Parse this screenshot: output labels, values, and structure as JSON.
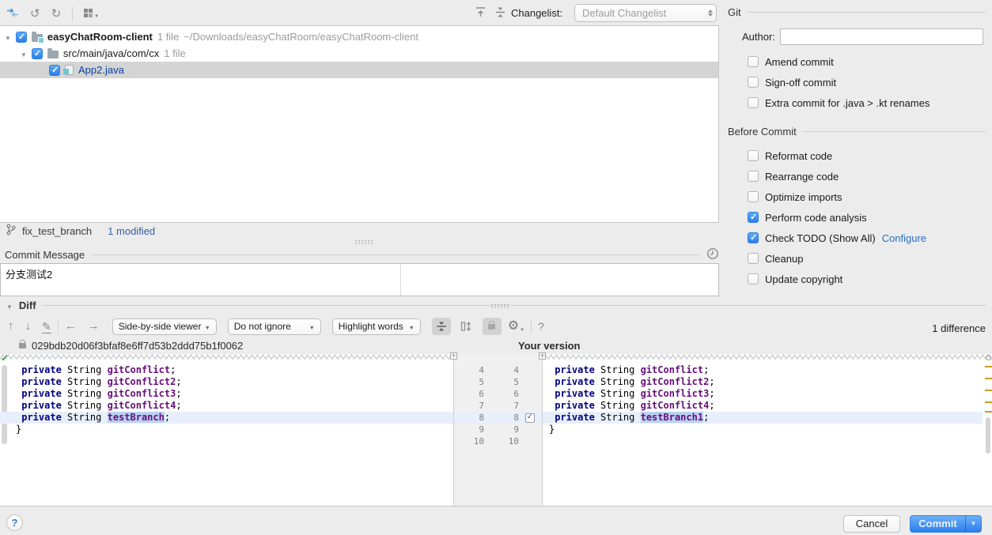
{
  "toolbar": {
    "changelist_label": "Changelist:",
    "changelist_value": "Default Changelist"
  },
  "tree": {
    "rows": [
      {
        "name": "easyChatRoom-client",
        "count": "1 file",
        "path": "~/Downloads/easyChatRoom/easyChatRoom-client"
      },
      {
        "name": "src/main/java/com/cx",
        "count": "1 file",
        "path": ""
      },
      {
        "name": "App2.java",
        "count": "",
        "path": ""
      }
    ]
  },
  "branch_bar": {
    "branch": "fix_test_branch",
    "modified": "1 modified"
  },
  "commit_message": {
    "title": "Commit Message",
    "text": "分支测试2"
  },
  "git_panel": {
    "title": "Git",
    "author_label": "Author:",
    "author_value": "",
    "options": [
      {
        "label": "Amend commit",
        "checked": false
      },
      {
        "label": "Sign-off commit",
        "checked": false
      },
      {
        "label": "Extra commit for .java > .kt renames",
        "checked": false
      }
    ],
    "before_commit_title": "Before Commit",
    "before_commit_options": [
      {
        "label": "Reformat code",
        "checked": false
      },
      {
        "label": "Rearrange code",
        "checked": false
      },
      {
        "label": "Optimize imports",
        "checked": false
      },
      {
        "label": "Perform code analysis",
        "checked": true
      },
      {
        "label": "Check TODO (Show All)",
        "checked": true,
        "link": "Configure"
      },
      {
        "label": "Cleanup",
        "checked": false
      },
      {
        "label": "Update copyright",
        "checked": false
      }
    ]
  },
  "diff": {
    "title": "Diff",
    "difference_count": "1 difference",
    "viewer_dropdown": "Side-by-side viewer",
    "ignore_dropdown": "Do not ignore",
    "highlight_dropdown": "Highlight words",
    "help": "?",
    "left_title": "029bdb20d06f3bfaf8e6ff7d53b2ddd75b1f0062",
    "right_title": "Your version",
    "gutter_rows": [
      {
        "left": "4",
        "right": "4"
      },
      {
        "left": "5",
        "right": "5"
      },
      {
        "left": "6",
        "right": "6"
      },
      {
        "left": "7",
        "right": "7"
      },
      {
        "left": "8",
        "right": "8",
        "checked": true,
        "highlight": true
      },
      {
        "left": "9",
        "right": "9"
      },
      {
        "left": "10",
        "right": "10"
      }
    ],
    "left_code": [
      {
        "tokens": [
          {
            "t": " ",
            "c": "pl"
          },
          {
            "t": "private",
            "c": "kw"
          },
          {
            "t": " String ",
            "c": "pl"
          },
          {
            "t": "gitConflict",
            "c": "fld"
          },
          {
            "t": ";",
            "c": "pl"
          }
        ]
      },
      {
        "tokens": [
          {
            "t": " ",
            "c": "pl"
          },
          {
            "t": "private",
            "c": "kw"
          },
          {
            "t": " String ",
            "c": "pl"
          },
          {
            "t": "gitConflict2",
            "c": "fld"
          },
          {
            "t": ";",
            "c": "pl"
          }
        ]
      },
      {
        "tokens": [
          {
            "t": " ",
            "c": "pl"
          },
          {
            "t": "private",
            "c": "kw"
          },
          {
            "t": " String ",
            "c": "pl"
          },
          {
            "t": "gitConflict3",
            "c": "fld"
          },
          {
            "t": ";",
            "c": "pl"
          }
        ]
      },
      {
        "tokens": [
          {
            "t": " ",
            "c": "pl"
          },
          {
            "t": "private",
            "c": "kw"
          },
          {
            "t": " String ",
            "c": "pl"
          },
          {
            "t": "gitConflict4",
            "c": "fld"
          },
          {
            "t": ";",
            "c": "pl"
          }
        ]
      },
      {
        "highlight": true,
        "tokens": [
          {
            "t": " ",
            "c": "pl"
          },
          {
            "t": "private",
            "c": "kw"
          },
          {
            "t": " String ",
            "c": "pl"
          },
          {
            "t": "testBranch",
            "c": "fld sel"
          },
          {
            "t": ";",
            "c": "pl"
          }
        ]
      },
      {
        "tokens": [
          {
            "t": "}",
            "c": "pl"
          }
        ]
      }
    ],
    "right_code": [
      {
        "tokens": [
          {
            "t": " ",
            "c": "pl"
          },
          {
            "t": "private",
            "c": "kw"
          },
          {
            "t": " String ",
            "c": "pl"
          },
          {
            "t": "gitConflict",
            "c": "fld"
          },
          {
            "t": ";",
            "c": "pl"
          }
        ]
      },
      {
        "tokens": [
          {
            "t": " ",
            "c": "pl"
          },
          {
            "t": "private",
            "c": "kw"
          },
          {
            "t": " String ",
            "c": "pl"
          },
          {
            "t": "gitConflict2",
            "c": "fld"
          },
          {
            "t": ";",
            "c": "pl"
          }
        ]
      },
      {
        "tokens": [
          {
            "t": " ",
            "c": "pl"
          },
          {
            "t": "private",
            "c": "kw"
          },
          {
            "t": " String ",
            "c": "pl"
          },
          {
            "t": "gitConflict3",
            "c": "fld"
          },
          {
            "t": ";",
            "c": "pl"
          }
        ]
      },
      {
        "tokens": [
          {
            "t": " ",
            "c": "pl"
          },
          {
            "t": "private",
            "c": "kw"
          },
          {
            "t": " String ",
            "c": "pl"
          },
          {
            "t": "gitConflict4",
            "c": "fld"
          },
          {
            "t": ";",
            "c": "pl"
          }
        ]
      },
      {
        "highlight": true,
        "tokens": [
          {
            "t": " ",
            "c": "pl"
          },
          {
            "t": "private",
            "c": "kw"
          },
          {
            "t": " String ",
            "c": "pl"
          },
          {
            "t": "testBranch1",
            "c": "fld sel"
          },
          {
            "t": ";",
            "c": "pl"
          }
        ]
      },
      {
        "tokens": [
          {
            "t": "}",
            "c": "pl"
          }
        ]
      }
    ]
  },
  "footer": {
    "cancel": "Cancel",
    "commit": "Commit",
    "help": "?"
  }
}
